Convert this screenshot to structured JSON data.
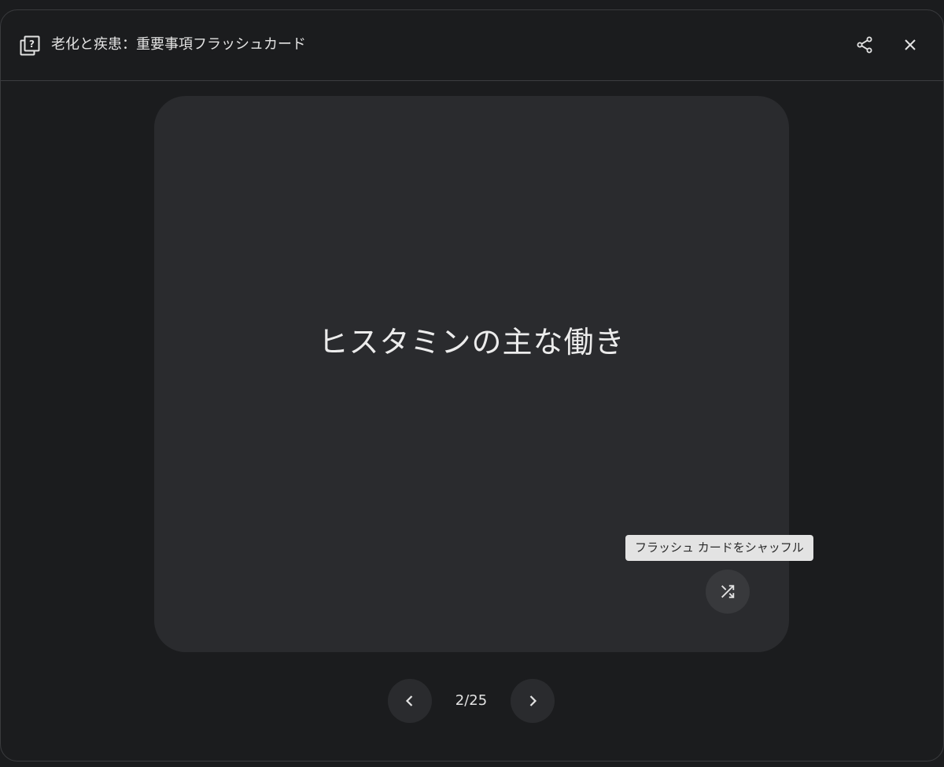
{
  "header": {
    "title": "老化と疾患：重要事項フラッシュカード",
    "icon": "flashcard-icon",
    "share_icon": "share-icon",
    "close_icon": "close-icon"
  },
  "card": {
    "text": "ヒスタミンの主な働き"
  },
  "shuffle": {
    "tooltip": "フラッシュ カードをシャッフル",
    "icon": "shuffle-icon"
  },
  "pagination": {
    "current": 2,
    "total": 25,
    "label": "2/25",
    "prev_icon": "chevron-left-icon",
    "next_icon": "chevron-right-icon"
  },
  "colors": {
    "background": "#1b1c1e",
    "card": "#2a2b2e",
    "text": "#e3e3e3",
    "tooltip_bg": "#e3e3e3"
  }
}
